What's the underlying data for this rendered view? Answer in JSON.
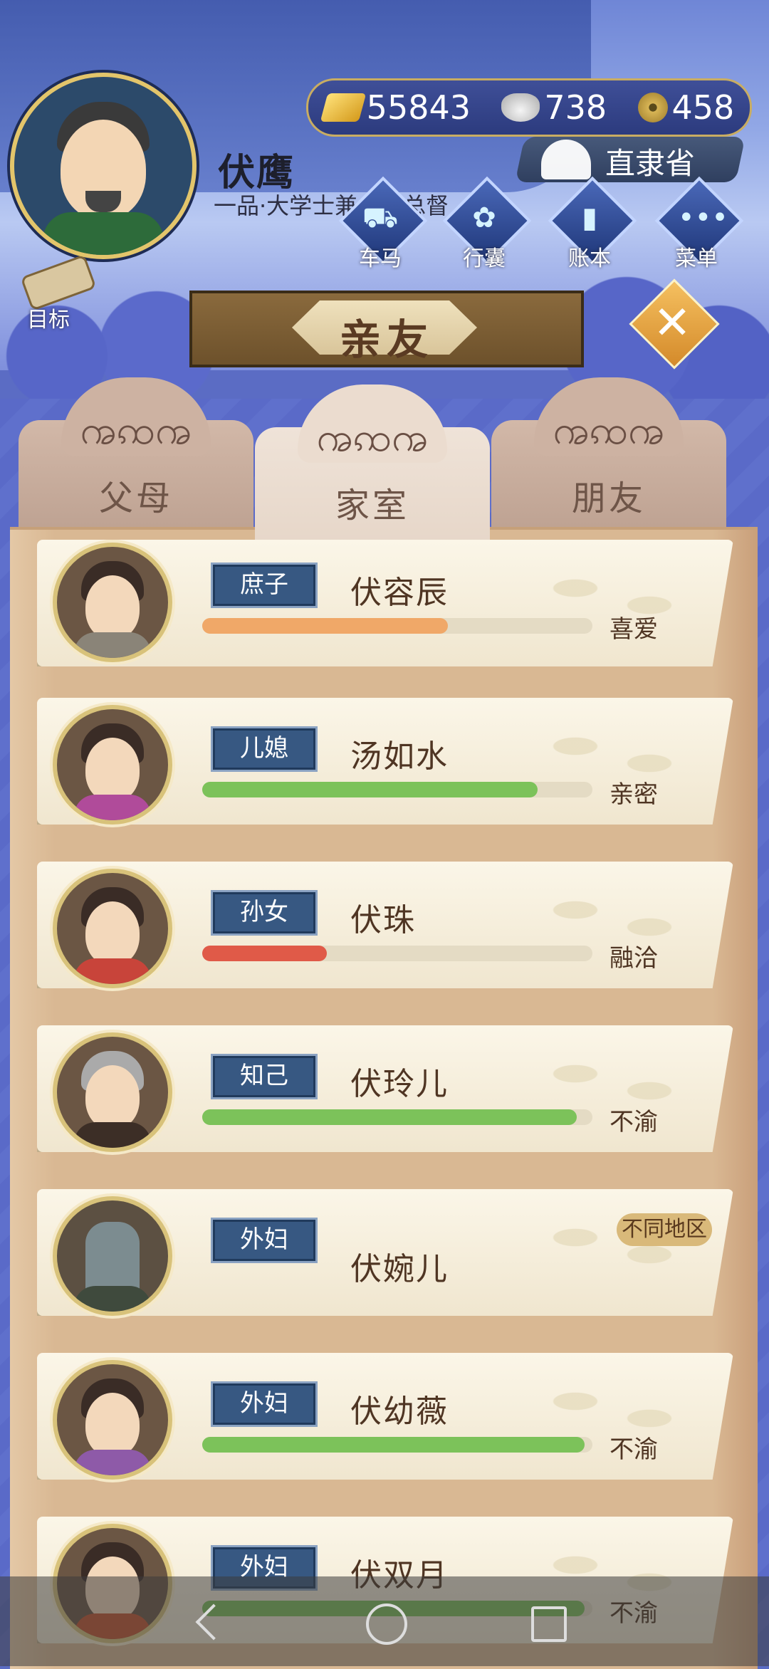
{
  "player": {
    "name": "伏鹰",
    "title": "一品·大学士兼……总督"
  },
  "currency": {
    "gold": "55843",
    "silver": "738",
    "coin": "458"
  },
  "region": {
    "name": "直隶省"
  },
  "nav": [
    {
      "label": "车马",
      "icon": "carriage-icon"
    },
    {
      "label": "行囊",
      "icon": "bundle-icon"
    },
    {
      "label": "账本",
      "icon": "ledger-icon"
    },
    {
      "label": "菜单",
      "icon": "menu-icon"
    }
  ],
  "goal": {
    "label": "目标"
  },
  "banner": {
    "title": "亲友"
  },
  "tabs": [
    {
      "label": "父母",
      "active": false
    },
    {
      "label": "家室",
      "active": true
    },
    {
      "label": "朋友",
      "active": false
    }
  ],
  "relatives": [
    {
      "relation": "庶子",
      "name": "伏容辰",
      "status": "喜爱",
      "affection": 0.63,
      "bar_color": "#f0a868"
    },
    {
      "relation": "儿媳",
      "name": "汤如水",
      "status": "亲密",
      "affection": 0.86,
      "bar_color": "#7cc25a"
    },
    {
      "relation": "孙女",
      "name": "伏珠",
      "status": "融洽",
      "affection": 0.32,
      "bar_color": "#e05a48"
    },
    {
      "relation": "知己",
      "name": "伏玲儿",
      "status": "不渝",
      "affection": 0.96,
      "bar_color": "#7cc25a"
    },
    {
      "relation": "外妇",
      "name": "伏婉儿",
      "status": "",
      "affection": null,
      "chip": "不同地区"
    },
    {
      "relation": "外妇",
      "name": "伏幼薇",
      "status": "不渝",
      "affection": 0.98,
      "bar_color": "#7cc25a"
    },
    {
      "relation": "外妇",
      "name": "伏双月",
      "status": "不渝",
      "affection": 0.98,
      "bar_color": "#7cc25a"
    }
  ]
}
